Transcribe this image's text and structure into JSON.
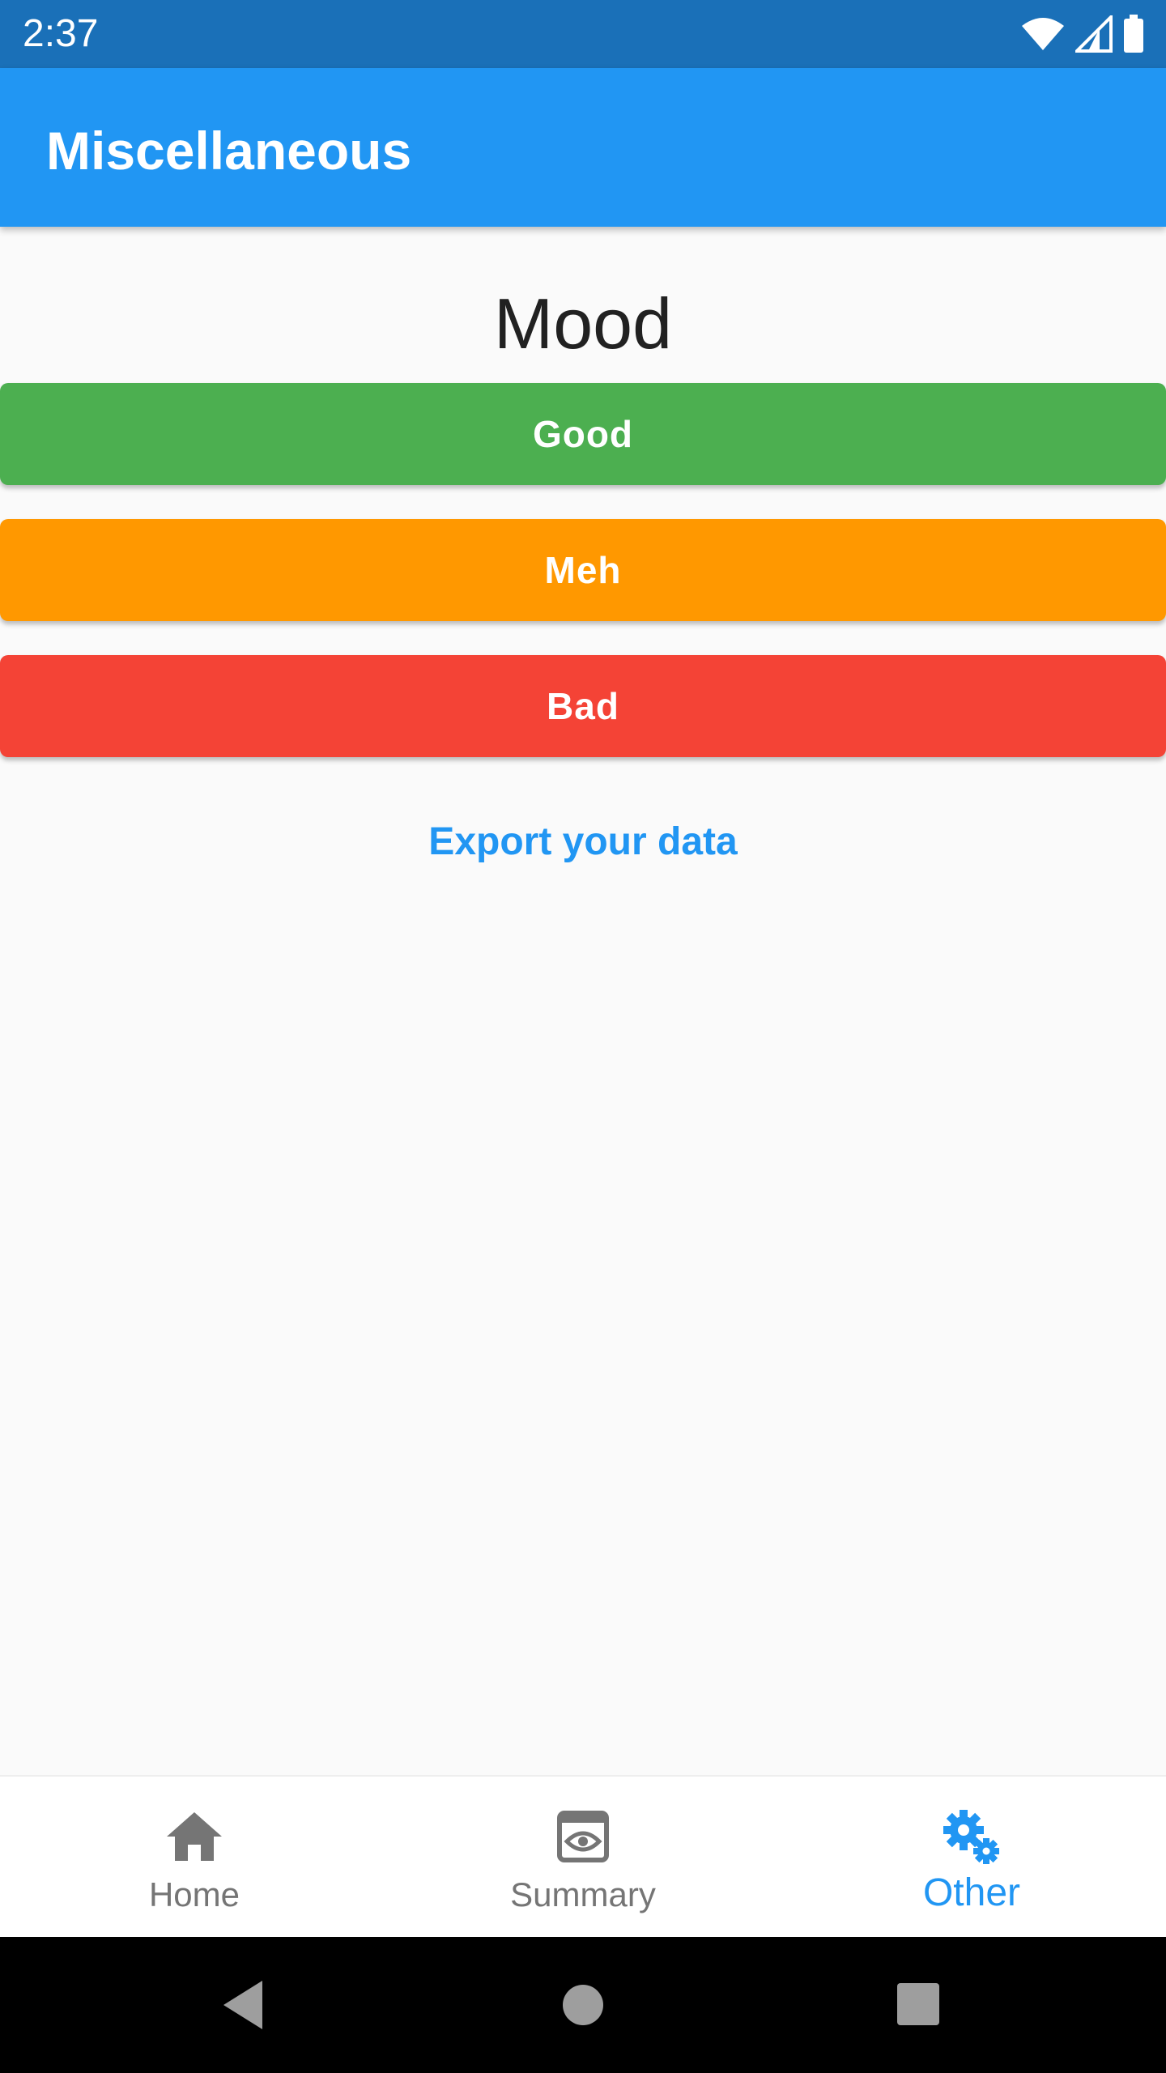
{
  "status_bar": {
    "time": "2:37",
    "icons": [
      "wifi-icon",
      "signal-icon",
      "battery-icon"
    ]
  },
  "app_bar": {
    "title": "Miscellaneous"
  },
  "mood": {
    "title": "Mood",
    "buttons": [
      {
        "label": "Good",
        "color": "#4caf50"
      },
      {
        "label": "Meh",
        "color": "#ff9800"
      },
      {
        "label": "Bad",
        "color": "#f44336"
      }
    ]
  },
  "export": {
    "label": "Export your data"
  },
  "bottom_nav": {
    "items": [
      {
        "label": "Home",
        "icon": "home-icon",
        "active": false
      },
      {
        "label": "Summary",
        "icon": "eye-icon",
        "active": false
      },
      {
        "label": "Other",
        "icon": "gears-icon",
        "active": true
      }
    ]
  },
  "colors": {
    "primary": "#2196f3",
    "status_bar": "#1a70b8",
    "inactive": "#757575"
  },
  "system_nav": {
    "buttons": [
      "back-icon",
      "home-circle-icon",
      "recents-icon"
    ]
  }
}
